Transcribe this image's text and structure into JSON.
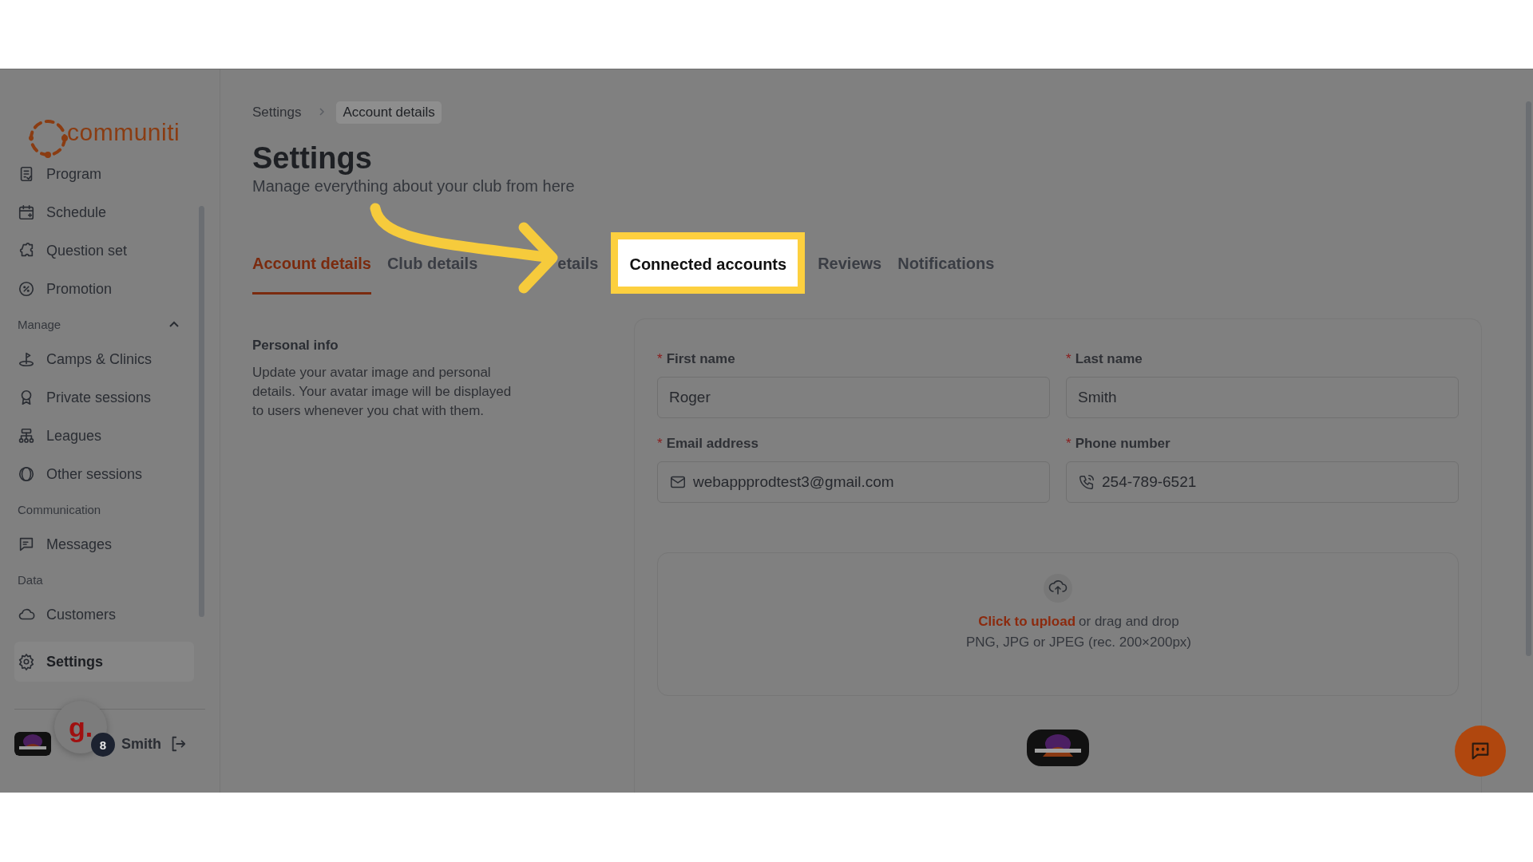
{
  "logo": {
    "text": "communiti"
  },
  "sidebar": {
    "items": [
      {
        "kind": "item",
        "label": "Program",
        "selected": false
      },
      {
        "kind": "item",
        "label": "Schedule",
        "selected": false
      },
      {
        "kind": "item",
        "label": "Question set",
        "selected": false
      },
      {
        "kind": "item",
        "label": "Promotion",
        "selected": false
      },
      {
        "kind": "section",
        "label": "Manage",
        "expanded": true
      },
      {
        "kind": "item",
        "label": "Camps & Clinics",
        "selected": false
      },
      {
        "kind": "item",
        "label": "Private sessions",
        "selected": false
      },
      {
        "kind": "item",
        "label": "Leagues",
        "selected": false
      },
      {
        "kind": "item",
        "label": "Other sessions",
        "selected": false
      },
      {
        "kind": "section",
        "label": "Communication"
      },
      {
        "kind": "item",
        "label": "Messages",
        "selected": false
      },
      {
        "kind": "section",
        "label": "Data"
      },
      {
        "kind": "item",
        "label": "Customers",
        "selected": false
      },
      {
        "kind": "item",
        "label": "Settings",
        "selected": true
      }
    ]
  },
  "user": {
    "name": "Smith"
  },
  "assistant_bubble": {
    "letter": "g.",
    "badge": "8"
  },
  "breadcrumb": [
    {
      "label": "Settings",
      "current": false
    },
    {
      "label": "Account details",
      "current": true
    }
  ],
  "page": {
    "title": "Settings",
    "subtitle": "Manage everything about your club from here"
  },
  "tabs": [
    {
      "label": "Account details",
      "selected": true,
      "highlighted": false
    },
    {
      "label": "Club details",
      "selected": false,
      "highlighted": false
    },
    {
      "label": "etails",
      "selected": false,
      "highlighted": false
    },
    {
      "label": "Connected accounts",
      "selected": false,
      "highlighted": true
    },
    {
      "label": "Reviews",
      "selected": false,
      "highlighted": false
    },
    {
      "label": "Notifications",
      "selected": false,
      "highlighted": false
    }
  ],
  "section": {
    "title": "Personal info",
    "description": "Update your avatar image and personal details. Your avatar image will be displayed to users whenever you chat with them."
  },
  "fields": [
    {
      "label": "First name",
      "value": "Roger",
      "required_mark": "*",
      "kind": "text"
    },
    {
      "label": "Last name",
      "value": "Smith",
      "required_mark": "*",
      "kind": "text"
    },
    {
      "label": "Email address",
      "value": "webappprodtest3@gmail.com",
      "required_mark": "*",
      "kind": "email"
    },
    {
      "label": "Phone number",
      "value": "254-789-6521",
      "required_mark": "*",
      "kind": "phone"
    }
  ],
  "upload": {
    "link": "Click to upload",
    "text": "or drag and drop",
    "hint": "PNG, JPG or JPEG (rec. 200×200px)"
  }
}
